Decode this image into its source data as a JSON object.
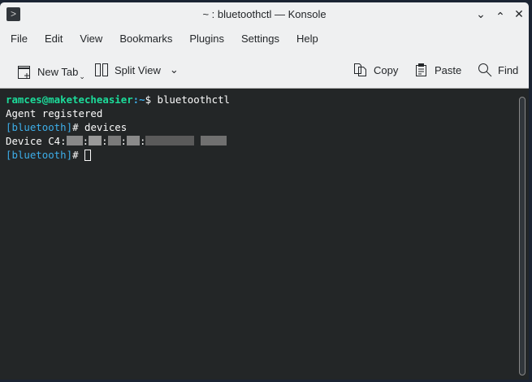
{
  "window": {
    "title": "~ : bluetoothctl — Konsole"
  },
  "menu": [
    "File",
    "Edit",
    "View",
    "Bookmarks",
    "Plugins",
    "Settings",
    "Help"
  ],
  "toolbar": {
    "new_tab": "New Tab",
    "split_view": "Split View",
    "copy": "Copy",
    "paste": "Paste",
    "find": "Find"
  },
  "terminal": {
    "prompt_user": "ramces@maketecheasier",
    "prompt_path": ":~",
    "prompt_symbol": "$ ",
    "command": "bluetoothctl",
    "line2": "Agent registered",
    "bt_prompt": "[bluetooth]",
    "bt_hash": "# ",
    "bt_cmd": "devices",
    "device_prefix": "Device C4:"
  }
}
